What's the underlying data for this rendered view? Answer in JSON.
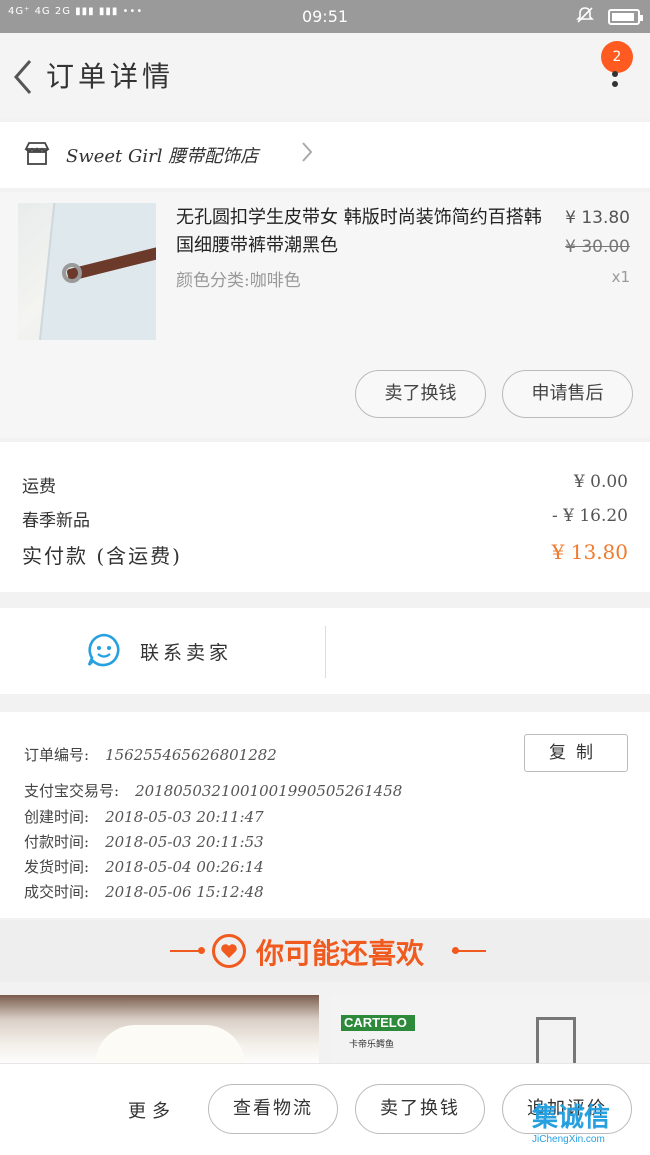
{
  "status_bar": {
    "network": "4G⁺ 4G 2G  ▮▮▮ ▮▮▮  •••",
    "time": "09:51"
  },
  "header": {
    "title": "订单详情",
    "badge_count": "2"
  },
  "shop": {
    "name": "Sweet Girl 腰带配饰店"
  },
  "product": {
    "title": "无孔圆扣学生皮带女 韩版时尚装饰简约百搭韩国细腰带裤带潮黑色",
    "sku": "颜色分类:咖啡色",
    "price": "¥ 13.80",
    "original_price": "¥ 30.00",
    "quantity": "x1",
    "actions": [
      "卖了换钱",
      "申请售后"
    ]
  },
  "fees": {
    "shipping_label": "运费",
    "shipping_value": "¥ 0.00",
    "promo_label": "春季新品",
    "promo_value": "- ¥ 16.20",
    "total_label": "实付款 (含运费)",
    "total_value": "¥ 13.80"
  },
  "contact": {
    "label": "联系卖家"
  },
  "order_info": {
    "order_no_label": "订单编号:",
    "order_no": "156255465626801282",
    "copy_label": "复制",
    "alipay_label": "支付宝交易号:",
    "alipay_no": "2018050321001001990505261458",
    "created_label": "创建时间:",
    "created": "2018-05-03 20:11:47",
    "paid_label": "付款时间:",
    "paid": "2018-05-03 20:11:53",
    "shipped_label": "发货时间:",
    "shipped": "2018-05-04 00:26:14",
    "completed_label": "成交时间:",
    "completed": "2018-05-06 15:12:48"
  },
  "recommend": {
    "title": "你可能还喜欢",
    "brand": "CARTELO",
    "brand_sub": "卡帝乐鳄鱼"
  },
  "bottom_bar": {
    "more": "更多",
    "buttons": [
      "查看物流",
      "卖了换钱",
      "追加评价"
    ]
  },
  "watermark": {
    "cn": "集诚信",
    "en": "JiChengXin.com"
  },
  "colors": {
    "accent": "#f05a1f",
    "badge": "#ff5a1f",
    "total_price": "#f07a2d",
    "chat_icon": "#27a0e0"
  }
}
